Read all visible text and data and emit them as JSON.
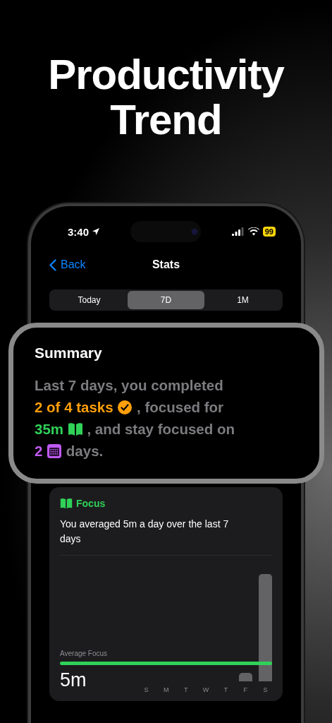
{
  "headline": "Productivity Trend",
  "status_bar": {
    "time": "3:40",
    "battery": "99"
  },
  "nav": {
    "back": "Back",
    "title": "Stats"
  },
  "tabs": [
    {
      "label": "Today",
      "selected": false
    },
    {
      "label": "7D",
      "selected": true
    },
    {
      "label": "1M",
      "selected": false
    }
  ],
  "summary": {
    "title": "Summary",
    "parts": [
      {
        "kind": "text",
        "text": "Last 7 days, you completed"
      },
      {
        "kind": "tasks",
        "text": "2 of 4 tasks",
        "color": "#ff9f0a"
      },
      {
        "kind": "text",
        "text": ", focused for"
      },
      {
        "kind": "minutes",
        "text": "35m",
        "color": "#30d158"
      },
      {
        "kind": "text",
        "text": ", and stay focused on"
      },
      {
        "kind": "days",
        "text": "2",
        "color": "#bf5af2"
      },
      {
        "kind": "text",
        "text": "days."
      }
    ]
  },
  "focus_card": {
    "title": "Focus",
    "message": "You averaged 5m a day over the last 7 days",
    "average_label": "Average Focus",
    "average_value": "5m",
    "days": [
      "S",
      "M",
      "T",
      "W",
      "T",
      "F",
      "S"
    ]
  }
}
